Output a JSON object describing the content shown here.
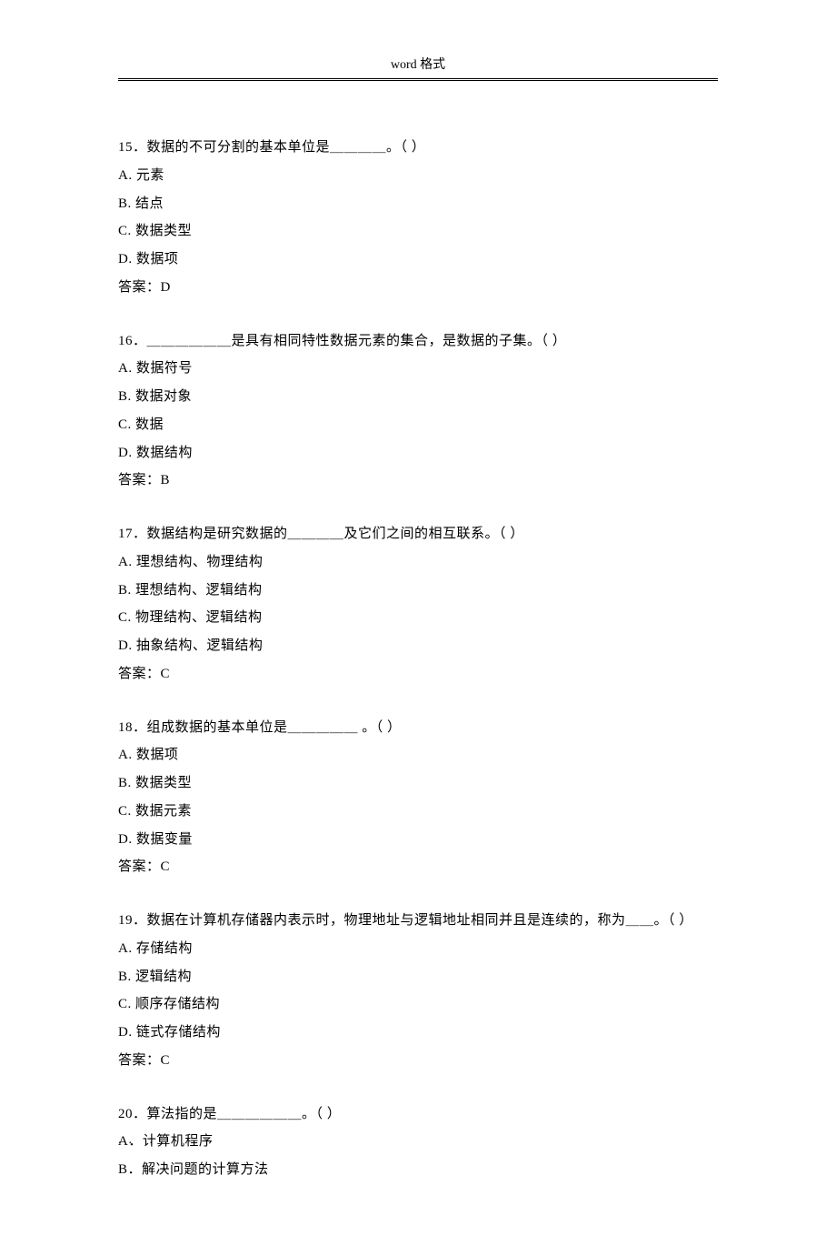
{
  "header": "word 格式",
  "footer": ".. ..",
  "questions": [
    {
      "number": "15",
      "text": "．数据的不可分割的基本单位是＿＿＿＿。（ ）",
      "options": [
        "A. 元素",
        "B. 结点",
        "C. 数据类型",
        "D. 数据项"
      ],
      "answer": "答案：D"
    },
    {
      "number": "16",
      "text": "．＿＿＿＿＿＿是具有相同特性数据元素的集合，是数据的子集。（ ）",
      "options": [
        "A. 数据符号",
        "B. 数据对象",
        "C. 数据",
        "D. 数据结构"
      ],
      "answer": "答案：B"
    },
    {
      "number": "17",
      "text": "．数据结构是研究数据的＿＿＿＿及它们之间的相互联系。（    ）",
      "options": [
        "A. 理想结构、物理结构",
        "B. 理想结构、逻辑结构",
        "C. 物理结构、逻辑结构",
        "D. 抽象结构、逻辑结构"
      ],
      "answer": "答案：C"
    },
    {
      "number": "18",
      "text": "．组成数据的基本单位是＿＿＿＿＿ 。（    ）",
      "options": [
        "A. 数据项",
        "B. 数据类型",
        "C. 数据元素",
        "D. 数据变量"
      ],
      "answer": "答案：C"
    },
    {
      "number": "19",
      "text": "．数据在计算机存储器内表示时，物理地址与逻辑地址相同并且是连续的，称为＿＿。（    ）",
      "options": [
        "A. 存储结构",
        "B. 逻辑结构",
        "C. 顺序存储结构",
        "D. 链式存储结构"
      ],
      "answer": "答案：C"
    },
    {
      "number": "20",
      "text": "．算法指的是＿＿＿＿＿＿。（    ）",
      "options": [
        "A．计算机程序",
        "B．解决问题的计算方法"
      ],
      "answer": ""
    }
  ]
}
